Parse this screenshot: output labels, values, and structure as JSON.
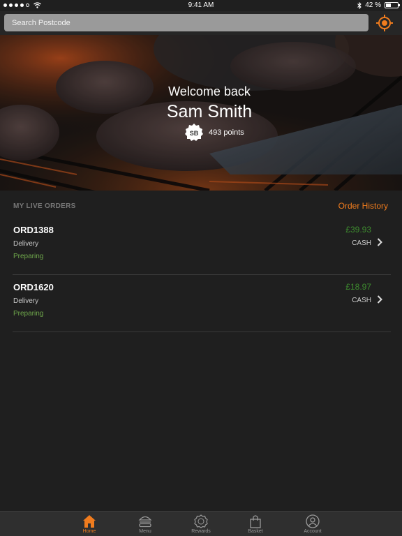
{
  "status_bar": {
    "time": "9:41 AM",
    "battery": "42 %",
    "battery_level": 0.42,
    "icons": [
      "signal-dots-icon",
      "wifi-icon",
      "bluetooth-icon",
      "battery-icon"
    ]
  },
  "search": {
    "placeholder": "Search Postcode",
    "value": "",
    "locate_icon": "locate-target-icon"
  },
  "hero": {
    "welcome": "Welcome back",
    "user_name": "Sam Smith",
    "badge_text": "SB",
    "points": "493 points"
  },
  "orders": {
    "section_title": "MY LIVE ORDERS",
    "history_link": "Order History",
    "items": [
      {
        "id": "ORD1388",
        "type": "Delivery",
        "status": "Preparing",
        "price": "£39.93",
        "payment": "CASH"
      },
      {
        "id": "ORD1620",
        "type": "Delivery",
        "status": "Preparing",
        "price": "£18.97",
        "payment": "CASH"
      }
    ]
  },
  "tab_bar": {
    "tabs": [
      {
        "label": "Home",
        "icon": "home-icon",
        "active": true
      },
      {
        "label": "Menu",
        "icon": "burger-icon",
        "active": false
      },
      {
        "label": "Rewards",
        "icon": "rewards-badge-icon",
        "active": false
      },
      {
        "label": "Basket",
        "icon": "shopping-bag-icon",
        "active": false
      },
      {
        "label": "Account",
        "icon": "user-icon",
        "active": false
      }
    ]
  },
  "colors": {
    "accent": "#f07c1e",
    "price_green": "#3e8c2f",
    "status_green": "#6fa84b",
    "background": "#1f1f1f"
  }
}
